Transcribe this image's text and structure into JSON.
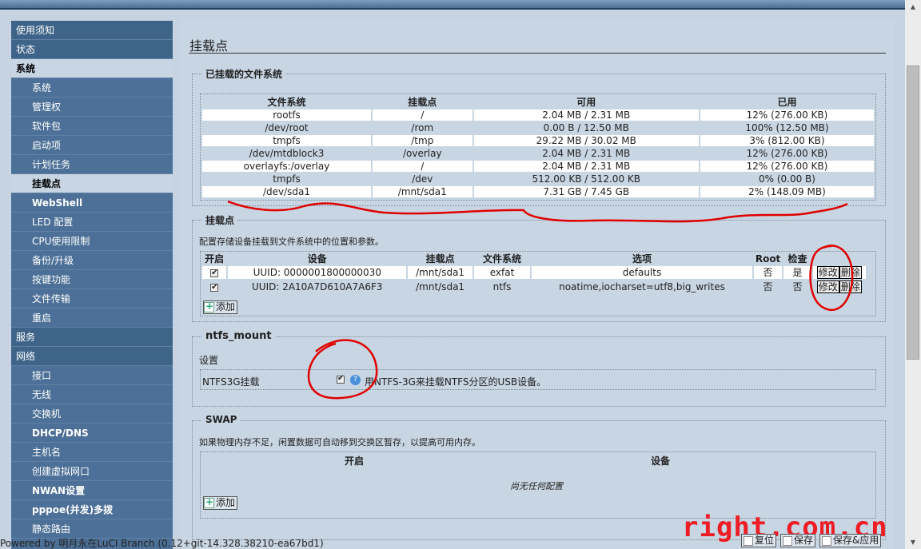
{
  "sidebar": {
    "items": [
      {
        "label": "使用须知",
        "level": 1
      },
      {
        "label": "状态",
        "level": 1
      },
      {
        "label": "系统",
        "level": 1,
        "active": true
      },
      {
        "label": "系统",
        "level": 2
      },
      {
        "label": "管理权",
        "level": 2
      },
      {
        "label": "软件包",
        "level": 2
      },
      {
        "label": "启动项",
        "level": 2
      },
      {
        "label": "计划任务",
        "level": 2
      },
      {
        "label": "挂载点",
        "level": 2,
        "active": true
      },
      {
        "label": "WebShell",
        "level": 2,
        "bold": true
      },
      {
        "label": "LED 配置",
        "level": 2
      },
      {
        "label": "CPU使用限制",
        "level": 2
      },
      {
        "label": "备份/升级",
        "level": 2
      },
      {
        "label": "按键功能",
        "level": 2
      },
      {
        "label": "文件传输",
        "level": 2
      },
      {
        "label": "重启",
        "level": 2
      },
      {
        "label": "服务",
        "level": 1
      },
      {
        "label": "网络",
        "level": 1
      },
      {
        "label": "接口",
        "level": 2
      },
      {
        "label": "无线",
        "level": 2
      },
      {
        "label": "交换机",
        "level": 2
      },
      {
        "label": "DHCP/DNS",
        "level": 2,
        "bold": true
      },
      {
        "label": "主机名",
        "level": 2
      },
      {
        "label": "创建虚拟网口",
        "level": 2
      },
      {
        "label": "NWAN设置",
        "level": 2,
        "bold": true
      },
      {
        "label": "pppoe(并发)多拨",
        "level": 2,
        "bold": true
      },
      {
        "label": "静态路由",
        "level": 2
      }
    ]
  },
  "page_title": "挂载点",
  "mounted": {
    "legend": "已挂载的文件系统",
    "headers": [
      "文件系统",
      "挂载点",
      "可用",
      "已用"
    ],
    "rows": [
      [
        "rootfs",
        "/",
        "2.04 MB / 2.31 MB",
        "12% (276.00 KB)"
      ],
      [
        "/dev/root",
        "/rom",
        "0.00 B / 12.50 MB",
        "100% (12.50 MB)"
      ],
      [
        "tmpfs",
        "/tmp",
        "29.22 MB / 30.02 MB",
        "3% (812.00 KB)"
      ],
      [
        "/dev/mtdblock3",
        "/overlay",
        "2.04 MB / 2.31 MB",
        "12% (276.00 KB)"
      ],
      [
        "overlayfs:/overlay",
        "/",
        "2.04 MB / 2.31 MB",
        "12% (276.00 KB)"
      ],
      [
        "tmpfs",
        "/dev",
        "512.00 KB / 512.00 KB",
        "0% (0.00 B)"
      ],
      [
        "/dev/sda1",
        "/mnt/sda1",
        "7.31 GB / 7.45 GB",
        "2% (148.09 MB)"
      ]
    ]
  },
  "mountpoints": {
    "legend": "挂载点",
    "description": "配置存储设备挂载到文件系统中的位置和参数。",
    "headers": [
      "开启",
      "设备",
      "挂载点",
      "文件系统",
      "选项",
      "Root",
      "检查"
    ],
    "rows": [
      {
        "enabled": true,
        "device": "UUID: 0000001800000030",
        "mount": "/mnt/sda1",
        "fs": "exfat",
        "options": "defaults",
        "root": "否",
        "check": "是"
      },
      {
        "enabled": true,
        "device": "UUID: 2A10A7D610A7A6F3",
        "mount": "/mnt/sda1",
        "fs": "ntfs",
        "options": "noatime,iocharset=utf8,big_writes",
        "root": "否",
        "check": "否"
      }
    ],
    "edit_label": "修改",
    "delete_label": "删除",
    "add_label": "添加"
  },
  "ntfs": {
    "legend": "ntfs_mount",
    "subtitle": "设置",
    "option_label": "NTFS3G挂载",
    "option_enabled": true,
    "option_desc": "用NTFS-3G来挂载NTFS分区的USB设备。"
  },
  "swap": {
    "legend": "SWAP",
    "description": "如果物理内存不足，闲置数据可自动移到交换区暂存，以提高可用内存。",
    "headers": [
      "开启",
      "设备"
    ],
    "empty_text": "尚无任何配置",
    "add_label": "添加"
  },
  "footer": {
    "powered_by": "Powered by 明月永在LuCI Branch (0.12+git-14.328.38210-ea67bd1)",
    "reset_label": "复位",
    "save_label": "保存",
    "save_apply_label": "保存&应用"
  },
  "watermark": "right.com.cn",
  "colors": {
    "sidebar_bg": "#4c7097",
    "content_bg": "#c8d5e3",
    "annotation_red": "#e00000",
    "watermark": "#ee1c24"
  }
}
